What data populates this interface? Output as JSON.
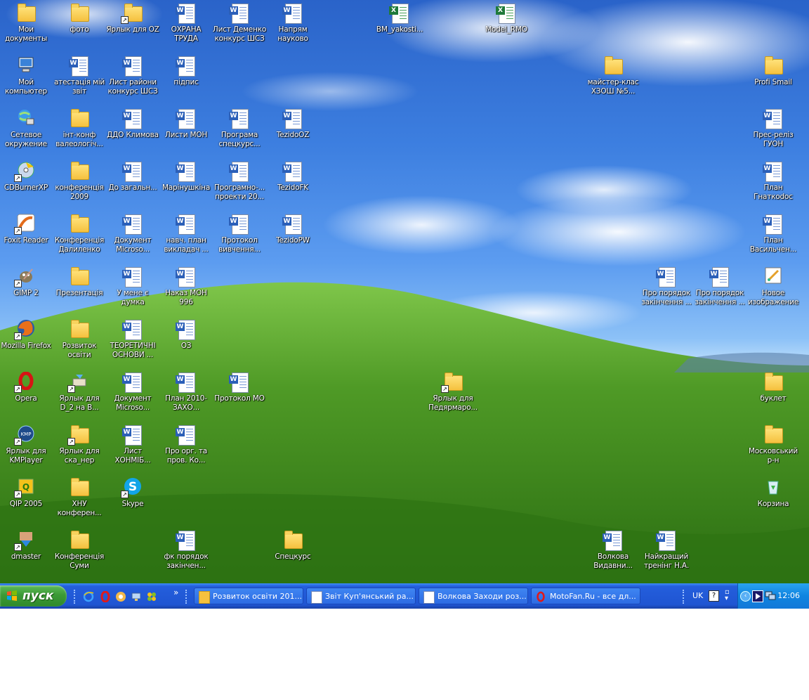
{
  "desktop": {
    "icons": [
      {
        "label": "Мои документы",
        "type": "folder"
      },
      {
        "label": "фото",
        "type": "folder"
      },
      {
        "label": "Ярлык для OZ",
        "type": "folder-shortcut"
      },
      {
        "label": "ОХРАНА ТРУДА",
        "type": "word"
      },
      {
        "label": "Лист Деменко конкурс ШСЗ",
        "type": "word"
      },
      {
        "label": "Напрям науково",
        "type": "word"
      },
      {
        "label": "BM_yakosti...",
        "type": "excel"
      },
      {
        "label": "Model_RMO",
        "type": "excel"
      },
      {
        "label": "Мой компьютер",
        "type": "computer"
      },
      {
        "label": "атестація мій звіт",
        "type": "word"
      },
      {
        "label": "Лист райони конкурс ШСЗ",
        "type": "word"
      },
      {
        "label": "підпис",
        "type": "word"
      },
      {
        "label": "майстер-клас ХЗОШ №5...",
        "type": "folder"
      },
      {
        "label": "Profi Smail",
        "type": "folder"
      },
      {
        "label": "Сетевое окружение",
        "type": "network"
      },
      {
        "label": "інт-конф валеологіч...",
        "type": "folder"
      },
      {
        "label": "ДДО Климова",
        "type": "word"
      },
      {
        "label": "Листи МОН",
        "type": "word"
      },
      {
        "label": "Програма спецкурс...",
        "type": "word"
      },
      {
        "label": "TezidoOZ",
        "type": "word"
      },
      {
        "label": "Прес-реліз ГУОН",
        "type": "word"
      },
      {
        "label": "CDBurnerXP",
        "type": "cd"
      },
      {
        "label": "конференція 2009",
        "type": "folder"
      },
      {
        "label": "До загальн...",
        "type": "word"
      },
      {
        "label": "Марінушкіна",
        "type": "word"
      },
      {
        "label": "Програмно-... проекти 20...",
        "type": "word"
      },
      {
        "label": "TezidoFK",
        "type": "word"
      },
      {
        "label": "План Гнаткodoc",
        "type": "word"
      },
      {
        "label": "Foxit Reader",
        "type": "foxit"
      },
      {
        "label": "Конференція Далиленко",
        "type": "folder"
      },
      {
        "label": "Документ Microso...",
        "type": "word"
      },
      {
        "label": "навч. план викладач ...",
        "type": "word"
      },
      {
        "label": "Протокол вивчення...",
        "type": "word"
      },
      {
        "label": "TezidoPW",
        "type": "word"
      },
      {
        "label": "План Васильчен...",
        "type": "word"
      },
      {
        "label": "GIMP 2",
        "type": "gimp"
      },
      {
        "label": "Презентація",
        "type": "folder"
      },
      {
        "label": "У мене є думка",
        "type": "word"
      },
      {
        "label": "Наказ МОН 996",
        "type": "word"
      },
      {
        "label": "Про порядок закінчення ...",
        "type": "word"
      },
      {
        "label": "Про порядок закінчення ...",
        "type": "word"
      },
      {
        "label": "Новое изображение",
        "type": "paint"
      },
      {
        "label": "Mozilla Firefox",
        "type": "firefox"
      },
      {
        "label": "Розвиток освіти",
        "type": "folder"
      },
      {
        "label": "ТЕОРЕТИЧНІ ОСНОВИ ...",
        "type": "word"
      },
      {
        "label": "ОЗ",
        "type": "word"
      },
      {
        "label": "Opera",
        "type": "opera"
      },
      {
        "label": "Ярлык для D_2 на В...",
        "type": "drive-shortcut"
      },
      {
        "label": "Документ Microso...",
        "type": "word"
      },
      {
        "label": "План 2010-ЗАХО...",
        "type": "word"
      },
      {
        "label": "Протокол МО",
        "type": "word"
      },
      {
        "label": "Ярлык для Педярмаро...",
        "type": "folder-shortcut"
      },
      {
        "label": "буклет",
        "type": "folder"
      },
      {
        "label": "Ярлык для KMPlayer",
        "type": "kmp"
      },
      {
        "label": "Ярлык для ска_нер",
        "type": "folder-shortcut"
      },
      {
        "label": "Лист ХОНМІБ...",
        "type": "word"
      },
      {
        "label": "Про орг. та пров. Ко...",
        "type": "word"
      },
      {
        "label": "Московський р-н",
        "type": "folder"
      },
      {
        "label": "QIP 2005",
        "type": "qip"
      },
      {
        "label": "ХНУ конферен...",
        "type": "folder"
      },
      {
        "label": "Skype",
        "type": "skype"
      },
      {
        "label": "Корзина",
        "type": "recycle"
      },
      {
        "label": "dmaster",
        "type": "dmaster"
      },
      {
        "label": "Конференція Суми",
        "type": "folder"
      },
      {
        "label": "фк порядок закінчен...",
        "type": "word"
      },
      {
        "label": "Спецкурс",
        "type": "folder"
      },
      {
        "label": "Волкова Видавни...",
        "type": "word"
      },
      {
        "label": "Найкращий тренінг Н.А.",
        "type": "word"
      }
    ]
  },
  "taskbar": {
    "start_label": "пуск",
    "quick_launch": [
      "ie-icon",
      "opera-icon",
      "browser-icon",
      "network-icon",
      "qip-icon"
    ],
    "overflow": "»",
    "tasks": [
      {
        "label": "Розвиток освіти 201...",
        "icon": "folder-icon"
      },
      {
        "label": "Звіт Куп'янський ра...",
        "icon": "word-icon"
      },
      {
        "label": "Волкова Заходи роз...",
        "icon": "word-icon"
      },
      {
        "label": "MotoFan.Ru - все дл...",
        "icon": "opera-icon"
      }
    ],
    "language": "UK",
    "clock": "12:06"
  }
}
